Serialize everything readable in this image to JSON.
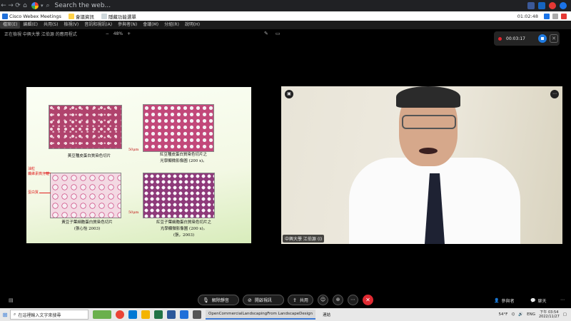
{
  "browser": {
    "address_text": "Search the web...",
    "colors": {
      "frame": "#202124",
      "accent": "#1a73e8"
    }
  },
  "bookmarks": {
    "items": [
      "Cisco Webex Meetings",
      "會議資訊",
      "隱藏功能選單"
    ],
    "clock": "01:02:48"
  },
  "menubar": {
    "items": [
      "檔案(E)",
      "編輯(E)",
      "共用(S)",
      "檢視(V)",
      "音訊和視訊(A)",
      "參與者(N)",
      "會議(M)",
      "分組(R)",
      "說明(H)"
    ],
    "active_index": 0
  },
  "share": {
    "title": "正在檢視 中興大學 江伯源 的應用程式",
    "zoom_value": "48%"
  },
  "recording": {
    "time": "00:03:17"
  },
  "slide": {
    "caption_top_left": "黃豆種皮蛋白質染色切片",
    "caption_top_right_1": "紅豆種皮蛋白質染色切片之",
    "caption_top_right_2": "光學顯微影像圖 (200 x)。",
    "caption_bottom_left_1": "黃豆子葉細胞蛋白質染色切片",
    "caption_bottom_left_2": "(張心怡 2003)",
    "caption_bottom_right_1": "紅豆子葉細胞蛋白質染色切片之",
    "caption_bottom_right_2": "光學顯微影像圖 (200 x)。",
    "caption_bottom_right_3": "(張，2003)",
    "label_oil_1": "油粒",
    "label_oil_2": "纖維素微分離",
    "label_protein": "蛋白質",
    "scale_top": "50μm",
    "scale_bottom": "50μm"
  },
  "video": {
    "participant_name": "中興大學 江伯源 (I)"
  },
  "controls": {
    "unmute_label": "解除靜音",
    "video_label": "開啟視訊",
    "share_label": "共用",
    "participants_label": "參與者",
    "chat_label": "聊天"
  },
  "taskbar": {
    "search_placeholder": "在這裡輸入文字來搜尋",
    "open_task": "OpenCommercialLandscapingFrom LandscapeDesign",
    "locale_label": "連結",
    "weather": "54°F",
    "lang": "ENG",
    "time": "下午 03:54",
    "date": "2022/11/27"
  }
}
